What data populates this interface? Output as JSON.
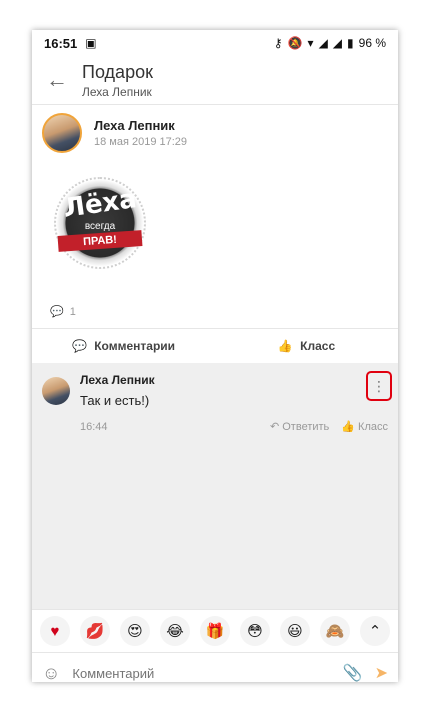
{
  "status": {
    "time": "16:51",
    "battery": "96 %"
  },
  "header": {
    "title": "Подарок",
    "subtitle": "Леха Лепник"
  },
  "post": {
    "author": "Леха Лепник",
    "date": "18 мая 2019 17:29",
    "gift": {
      "line1": "Лёха",
      "line2": "всегда",
      "line3": "ПРАВ!"
    },
    "comment_count": "1",
    "actions": {
      "comments": "Комментарии",
      "like": "Класс"
    }
  },
  "comment": {
    "author": "Леха Лепник",
    "text": "Так и есть!)",
    "time": "16:44",
    "reply": "Ответить",
    "like": "Класс"
  },
  "input": {
    "placeholder": "Комментарий"
  },
  "emojis": [
    "heart",
    "lips",
    "heart-eyes",
    "laughing",
    "gift",
    "flushed",
    "grin",
    "monkey",
    "expand"
  ]
}
